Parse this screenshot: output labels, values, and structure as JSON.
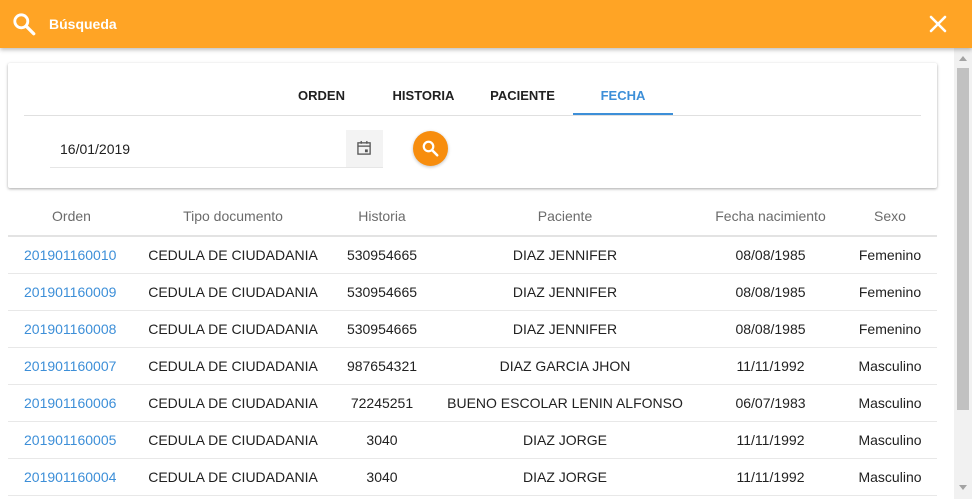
{
  "header": {
    "title": "Búsqueda",
    "bg_color": "#ffa425",
    "search_icon": "search-icon",
    "close_icon": "close-icon"
  },
  "tabs": [
    {
      "label": "ORDEN",
      "active": false
    },
    {
      "label": "HISTORIA",
      "active": false
    },
    {
      "label": "PACIENTE",
      "active": false
    },
    {
      "label": "FECHA",
      "active": true
    }
  ],
  "accent_color": "#3d8fd8",
  "date_field": {
    "value": "16/01/2019",
    "calendar_icon": "calendar-icon"
  },
  "search_button": {
    "icon": "search-icon",
    "color": "#f78d0e"
  },
  "table": {
    "columns": [
      "Orden",
      "Tipo documento",
      "Historia",
      "Paciente",
      "Fecha nacimiento",
      "Sexo"
    ],
    "rows": [
      {
        "orden": "201901160010",
        "tipo": "CEDULA DE CIUDADANIA",
        "historia": "530954665",
        "paciente": "DIAZ JENNIFER",
        "fecha": "08/08/1985",
        "sexo": "Femenino"
      },
      {
        "orden": "201901160009",
        "tipo": "CEDULA DE CIUDADANIA",
        "historia": "530954665",
        "paciente": "DIAZ JENNIFER",
        "fecha": "08/08/1985",
        "sexo": "Femenino"
      },
      {
        "orden": "201901160008",
        "tipo": "CEDULA DE CIUDADANIA",
        "historia": "530954665",
        "paciente": "DIAZ JENNIFER",
        "fecha": "08/08/1985",
        "sexo": "Femenino"
      },
      {
        "orden": "201901160007",
        "tipo": "CEDULA DE CIUDADANIA",
        "historia": "987654321",
        "paciente": "DIAZ GARCIA JHON",
        "fecha": "11/11/1992",
        "sexo": "Masculino"
      },
      {
        "orden": "201901160006",
        "tipo": "CEDULA DE CIUDADANIA",
        "historia": "72245251",
        "paciente": "BUENO ESCOLAR LENIN ALFONSO",
        "fecha": "06/07/1983",
        "sexo": "Masculino"
      },
      {
        "orden": "201901160005",
        "tipo": "CEDULA DE CIUDADANIA",
        "historia": "3040",
        "paciente": "DIAZ JORGE",
        "fecha": "11/11/1992",
        "sexo": "Masculino"
      },
      {
        "orden": "201901160004",
        "tipo": "CEDULA DE CIUDADANIA",
        "historia": "3040",
        "paciente": "DIAZ JORGE",
        "fecha": "11/11/1992",
        "sexo": "Masculino"
      }
    ]
  }
}
